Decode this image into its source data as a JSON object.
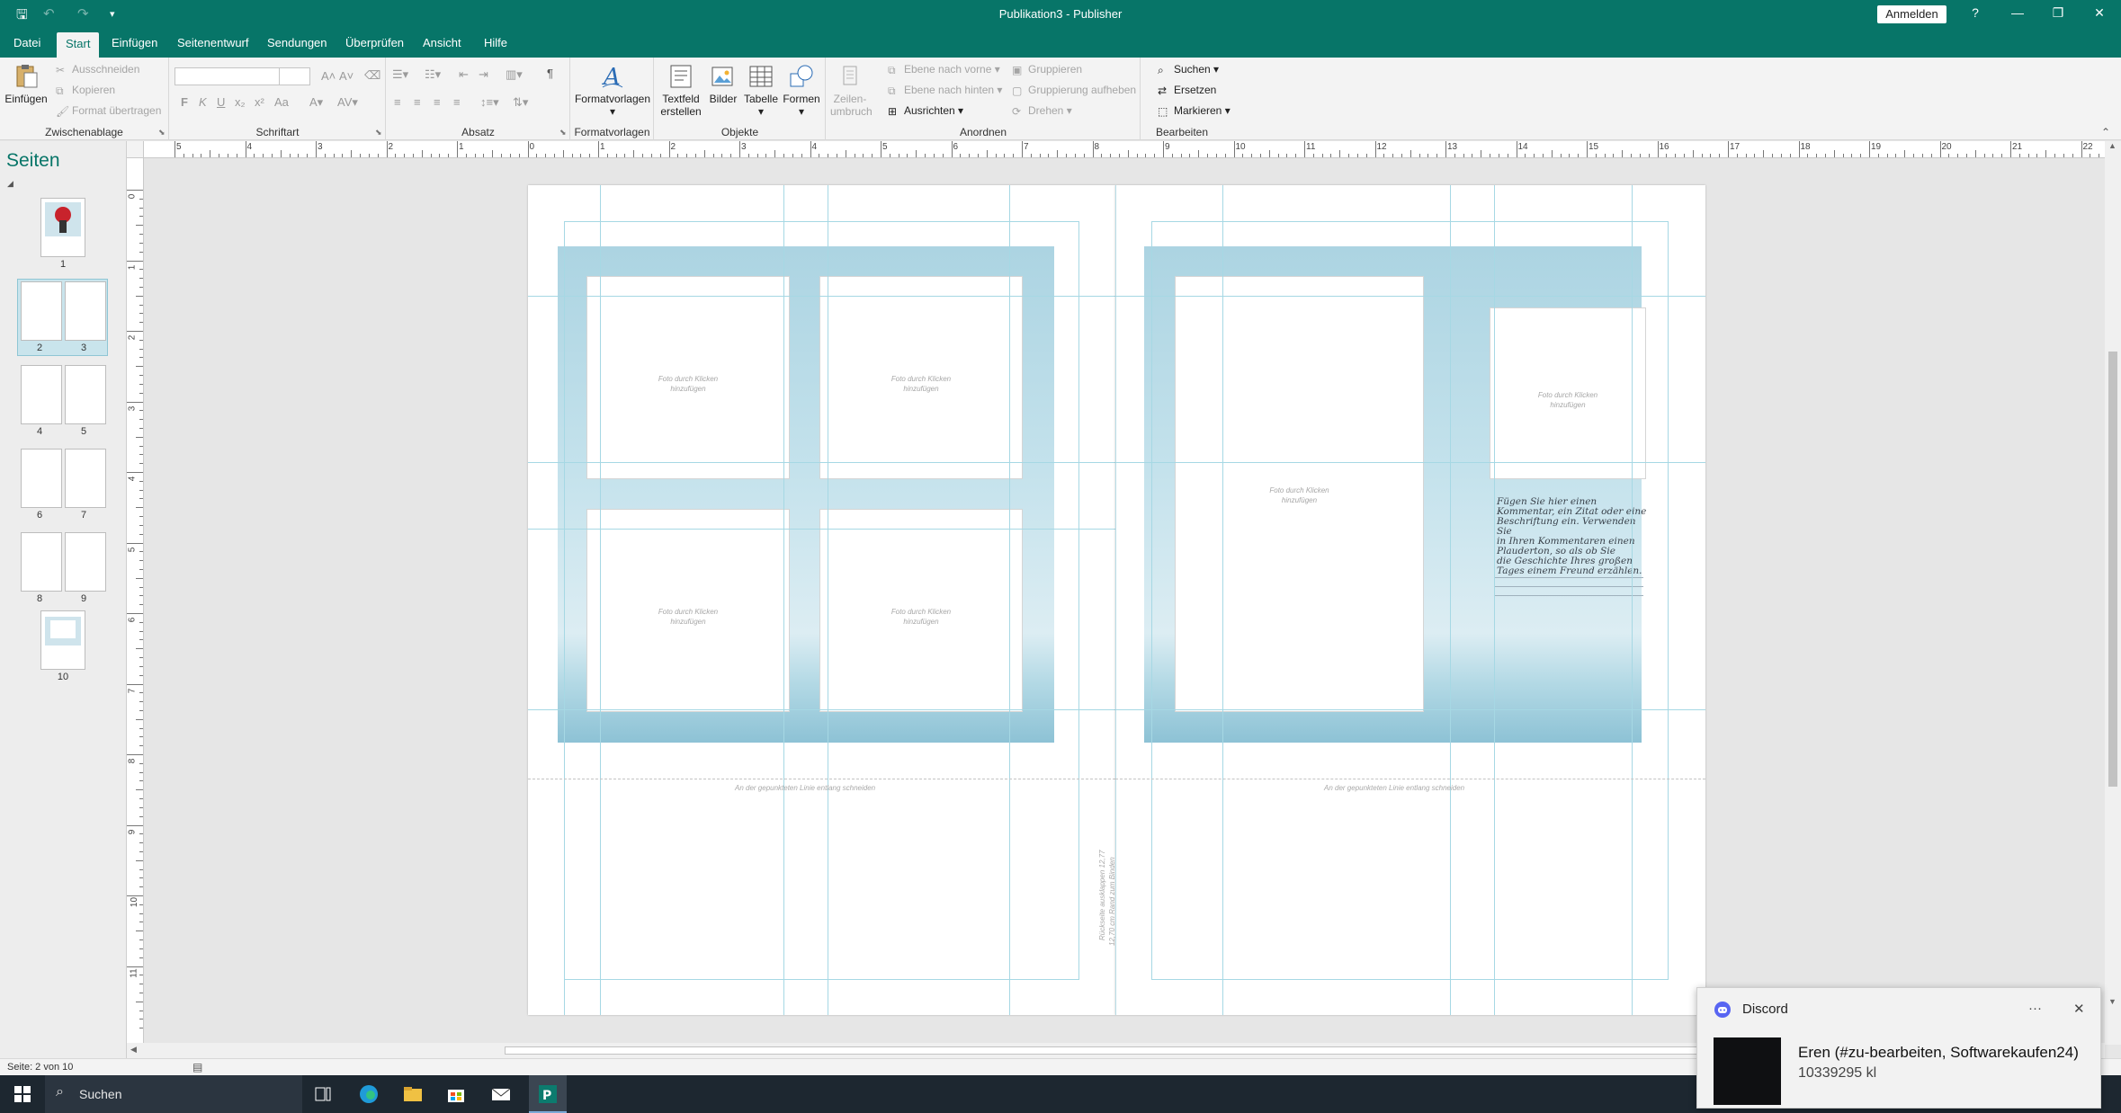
{
  "window": {
    "title": "Publikation3  -  Publisher",
    "sign_in": "Anmelden",
    "help": "?"
  },
  "tabs": [
    "Datei",
    "Start",
    "Einfügen",
    "Seitenentwurf",
    "Sendungen",
    "Überprüfen",
    "Ansicht",
    "Hilfe"
  ],
  "active_tab": "Start",
  "ribbon": {
    "clipboard": {
      "paste": "Einfügen",
      "cut": "Ausschneiden",
      "copy": "Kopieren",
      "format_painter": "Format übertragen",
      "label": "Zwischenablage"
    },
    "font": {
      "label": "Schriftart",
      "bold": "F",
      "italic": "K",
      "underline": "U",
      "sub": "x₂",
      "sup": "x²",
      "case": "Aa"
    },
    "paragraph": {
      "label": "Absatz",
      "pilcrow": "¶"
    },
    "styles": {
      "button": "Formatvorlagen",
      "label": "Formatvorlagen"
    },
    "objects": {
      "textbox_l1": "Textfeld",
      "textbox_l2": "erstellen",
      "pictures": "Bilder",
      "table": "Tabelle",
      "shapes": "Formen",
      "label": "Objekte"
    },
    "arrange": {
      "wrap_l1": "Zeilen-",
      "wrap_l2": "umbruch",
      "forward": "Ebene nach vorne",
      "backward": "Ebene nach hinten",
      "align": "Ausrichten",
      "group": "Gruppieren",
      "ungroup": "Gruppierung aufheben",
      "rotate": "Drehen",
      "label": "Anordnen"
    },
    "editing": {
      "find": "Suchen",
      "replace": "Ersetzen",
      "select": "Markieren",
      "label": "Bearbeiten"
    }
  },
  "pages_panel": {
    "title": "Seiten",
    "thumbs": [
      "1",
      "2",
      "3",
      "4",
      "5",
      "6",
      "7",
      "8",
      "9",
      "10"
    ]
  },
  "rulers": {
    "h": [
      "5",
      "4",
      "3",
      "2",
      "1",
      "0",
      "1",
      "2",
      "3",
      "4",
      "5",
      "6",
      "7",
      "8",
      "9",
      "10",
      "11",
      "12",
      "13",
      "14",
      "15",
      "16",
      "17",
      "18",
      "19",
      "20",
      "21",
      "22"
    ],
    "v": [
      "0",
      "1",
      "2",
      "3",
      "4",
      "5",
      "6",
      "7",
      "8",
      "9",
      "10",
      "11"
    ]
  },
  "document": {
    "photo_placeholder_l1": "Foto durch Klicken",
    "photo_placeholder_l2": "hinzufügen",
    "cut_line": "An der gepunkteten Linie entlang schneiden",
    "spine_l1": "Rückseite ausklappen 12,77",
    "spine_l2": "12,70 cm Rand zum Binden",
    "caption": [
      "Fügen Sie hier einen",
      "Kommentar, ein Zitat oder eine",
      "Beschriftung ein. Verwenden Sie",
      "in Ihren Kommentaren einen",
      "Plauderton, so als ob Sie",
      "die Geschichte Ihres großen",
      "Tages einem Freund erzählen."
    ]
  },
  "status": {
    "page": "Seite: 2 von 10"
  },
  "taskbar": {
    "search": "Suchen"
  },
  "notification": {
    "app": "Discord",
    "title": "Eren (#zu-bearbeiten, Softwarekaufen24)",
    "body": "10339295 kl",
    "more": "···",
    "close": "✕"
  },
  "colors": {
    "accent": "#077568",
    "sea": "#acd4e2",
    "guide": "#a6d8e4"
  }
}
